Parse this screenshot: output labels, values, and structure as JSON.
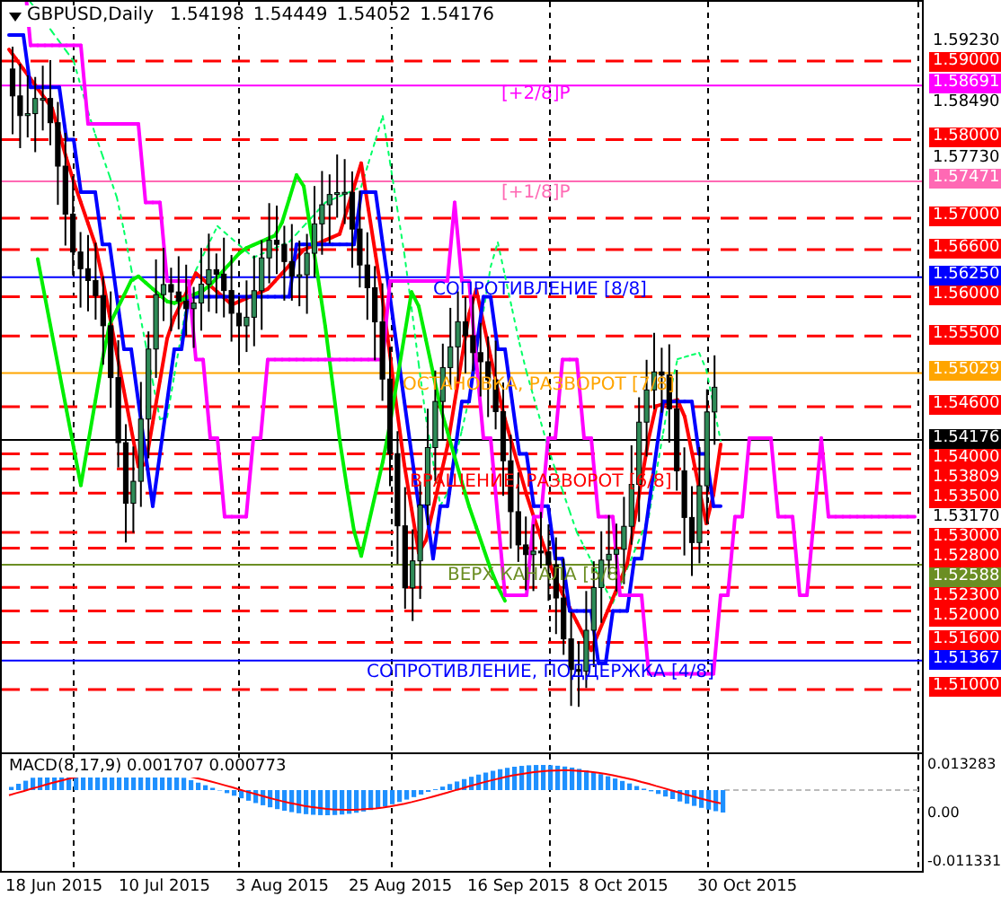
{
  "chart": {
    "symbol": "GBPUSD,Daily",
    "ohlc": [
      "1.54198",
      "1.54449",
      "1.54052",
      "1.54176"
    ]
  },
  "levels": [
    {
      "price": "1.59230",
      "kind": "tick"
    },
    {
      "price": "1.59000",
      "kind": "level",
      "color": "#ff0000"
    },
    {
      "price": "1.58691",
      "kind": "marker",
      "color": "#ff00ff"
    },
    {
      "price": "1.58490",
      "kind": "tick"
    },
    {
      "price": "1.58000",
      "kind": "level",
      "color": "#ff0000"
    },
    {
      "price": "1.57730",
      "kind": "tick"
    },
    {
      "price": "1.57471",
      "kind": "marker",
      "color": "#ff69b4"
    },
    {
      "price": "1.57000",
      "kind": "level",
      "color": "#ff0000"
    },
    {
      "price": "1.56600",
      "kind": "level",
      "color": "#ff0000"
    },
    {
      "price": "1.56250",
      "kind": "marker",
      "color": "#0000ff"
    },
    {
      "price": "1.56000",
      "kind": "level",
      "color": "#ff0000"
    },
    {
      "price": "1.55500",
      "kind": "level",
      "color": "#ff0000"
    },
    {
      "price": "1.55029",
      "kind": "marker",
      "color": "#ffa500"
    },
    {
      "price": "1.54600",
      "kind": "level",
      "color": "#ff0000"
    },
    {
      "price": "1.54176",
      "kind": "marker",
      "color": "#000000"
    },
    {
      "price": "1.54000",
      "kind": "level",
      "color": "#ff0000"
    },
    {
      "price": "1.53809",
      "kind": "level",
      "color": "#ff0000"
    },
    {
      "price": "1.53500",
      "kind": "level",
      "color": "#ff0000"
    },
    {
      "price": "1.53170",
      "kind": "tick"
    },
    {
      "price": "1.53000",
      "kind": "level",
      "color": "#ff0000"
    },
    {
      "price": "1.52800",
      "kind": "level",
      "color": "#ff0000"
    },
    {
      "price": "1.52588",
      "kind": "marker",
      "color": "#6b8e23"
    },
    {
      "price": "1.52300",
      "kind": "level",
      "color": "#ff0000"
    },
    {
      "price": "1.52000",
      "kind": "level",
      "color": "#ff0000"
    },
    {
      "price": "1.51600",
      "kind": "level",
      "color": "#ff0000"
    },
    {
      "price": "1.51367",
      "kind": "marker",
      "color": "#0000ff"
    },
    {
      "price": "1.51000",
      "kind": "level",
      "color": "#ff0000"
    }
  ],
  "labels": [
    {
      "text": "[+2/8]P",
      "color": "#ff00ff"
    },
    {
      "text": "[+1/8]P",
      "color": "#ff69b4"
    },
    {
      "text": "СОПРОТИВЛЕНИЕ [8/8]",
      "color": "#0000ff"
    },
    {
      "text": "ОСТАНОВКА, РАЗВОРОТ [7/8]",
      "color": "#ffa500"
    },
    {
      "text": "ВРАЩЕНИЕ, РАЗВОРОТ [6/8]",
      "color": "#ff0000"
    },
    {
      "text": "ВЕРХ КАНАЛА [5/8]",
      "color": "#6b8e23"
    },
    {
      "text": "СОПРОТИВЛЕНИЕ, ПОДДЕРЖКА [4/8]",
      "color": "#0000ff"
    }
  ],
  "macd": {
    "title": "MACD(8,17,9) 0.001707 0.000773",
    "ticks": [
      "0.013283",
      "0.00",
      "-0.011331"
    ]
  },
  "dates": [
    "18 Jun 2015",
    "10 Jul 2015",
    "3 Aug 2015",
    "25 Aug 2015",
    "16 Sep 2015",
    "8 Oct 2015",
    "30 Oct 2015"
  ]
}
